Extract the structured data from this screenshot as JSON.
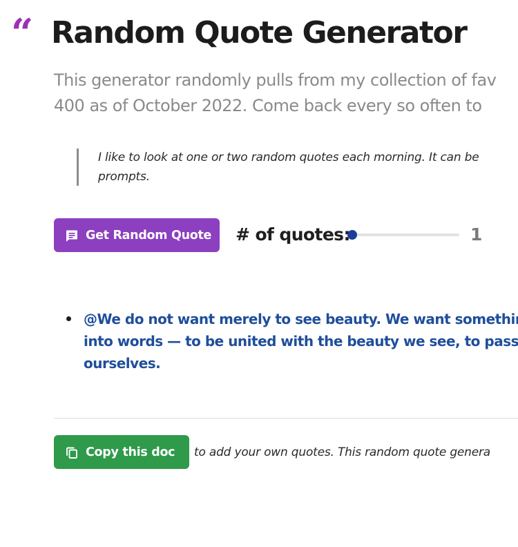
{
  "header": {
    "quote_mark": "“",
    "title": "Random Quote Generator"
  },
  "intro": {
    "line1": "This generator randomly pulls from my collection of fav",
    "line2": "400 as of October 2022. Come back every so often to"
  },
  "note": {
    "line1": "I like to look at one or two random quotes each morning. It can be",
    "line2": "prompts."
  },
  "controls": {
    "random_button_label": "Get Random Quote",
    "random_button_icon": "quote-card-icon",
    "counter_label": "# of quotes:",
    "slider_value": "1",
    "slider_fraction": 0.0
  },
  "quotes": {
    "lines": [
      "@We do not want merely to see beauty. We want something",
      "into words — to be united with the beauty we see, to pass in",
      "ourselves."
    ]
  },
  "footer": {
    "copy_button_label": "Copy this doc",
    "copy_button_icon": "copy-icon",
    "text": "to add your own quotes. This random quote genera"
  },
  "colors": {
    "accent_purple": "#8c3fbf",
    "quote_mark": "#9c2fb8",
    "copy_green": "#2e9a4a",
    "quote_blue": "#1f4e9b",
    "slider_thumb": "#1b3f98"
  }
}
